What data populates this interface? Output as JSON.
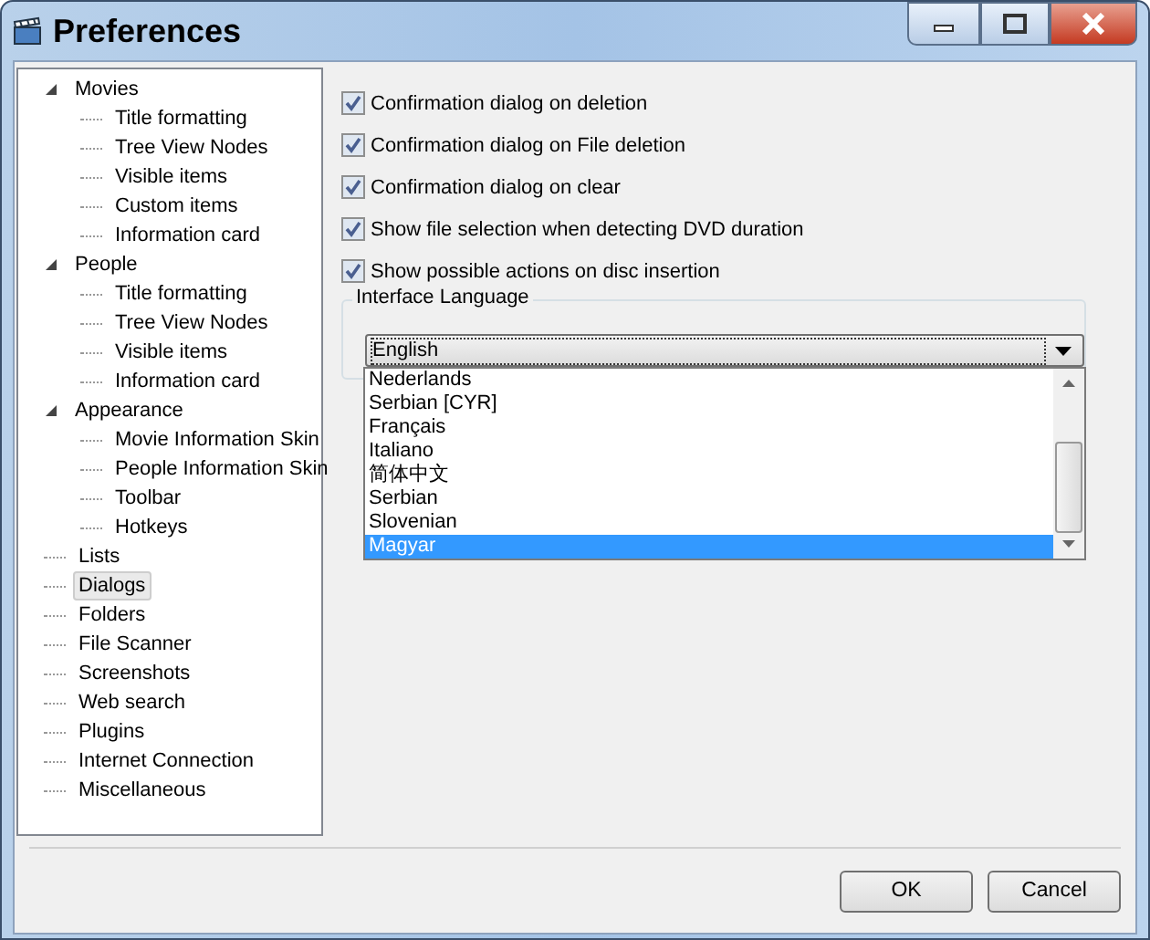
{
  "window": {
    "title": "Preferences"
  },
  "tree": [
    {
      "label": "Movies",
      "expanded": true,
      "selected": false,
      "children": [
        {
          "label": "Title formatting",
          "selected": false
        },
        {
          "label": "Tree View Nodes",
          "selected": false
        },
        {
          "label": "Visible items",
          "selected": false
        },
        {
          "label": "Custom items",
          "selected": false
        },
        {
          "label": "Information card",
          "selected": false
        }
      ]
    },
    {
      "label": "People",
      "expanded": true,
      "selected": false,
      "children": [
        {
          "label": "Title formatting",
          "selected": false
        },
        {
          "label": "Tree View Nodes",
          "selected": false
        },
        {
          "label": "Visible items",
          "selected": false
        },
        {
          "label": "Information card",
          "selected": false
        }
      ]
    },
    {
      "label": "Appearance",
      "expanded": true,
      "selected": false,
      "children": [
        {
          "label": "Movie Information Skin",
          "selected": false
        },
        {
          "label": "People Information Skin",
          "selected": false
        },
        {
          "label": "Toolbar",
          "selected": false
        },
        {
          "label": "Hotkeys",
          "selected": false
        }
      ]
    },
    {
      "label": "Lists",
      "selected": false
    },
    {
      "label": "Dialogs",
      "selected": true
    },
    {
      "label": "Folders",
      "selected": false
    },
    {
      "label": "File Scanner",
      "selected": false
    },
    {
      "label": "Screenshots",
      "selected": false
    },
    {
      "label": "Web search",
      "selected": false
    },
    {
      "label": "Plugins",
      "selected": false
    },
    {
      "label": "Internet Connection",
      "selected": false
    },
    {
      "label": "Miscellaneous",
      "selected": false
    }
  ],
  "options": [
    {
      "label": "Confirmation dialog on deletion",
      "checked": true
    },
    {
      "label": "Confirmation dialog on File deletion",
      "checked": true
    },
    {
      "label": "Confirmation dialog on clear",
      "checked": true
    },
    {
      "label": "Show file selection when detecting DVD duration",
      "checked": true
    },
    {
      "label": "Show possible actions on disc insertion",
      "checked": true
    }
  ],
  "language": {
    "title": "Interface Language",
    "value": "English",
    "list": [
      {
        "label": "Nederlands",
        "selected": false
      },
      {
        "label": "Serbian [CYR]",
        "selected": false
      },
      {
        "label": "Français",
        "selected": false
      },
      {
        "label": "Italiano",
        "selected": false
      },
      {
        "label": "简体中文",
        "selected": false
      },
      {
        "label": "Serbian",
        "selected": false
      },
      {
        "label": "Slovenian",
        "selected": false
      },
      {
        "label": "Magyar",
        "selected": true
      }
    ]
  },
  "buttons": [
    "OK",
    "Cancel"
  ]
}
